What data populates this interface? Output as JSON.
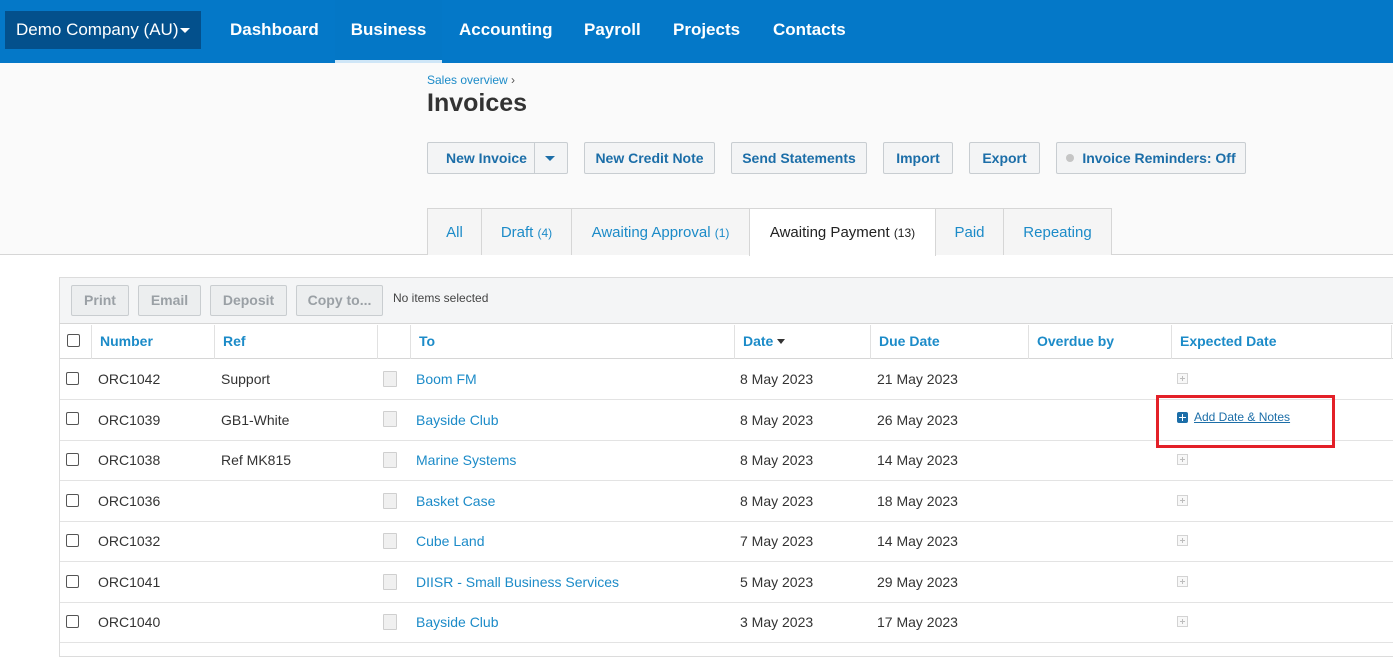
{
  "nav": {
    "org": "Demo Company (AU)",
    "items": [
      "Dashboard",
      "Business",
      "Accounting",
      "Payroll",
      "Projects",
      "Contacts"
    ]
  },
  "breadcrumb": {
    "link": "Sales overview",
    "sep": "›"
  },
  "page_title": "Invoices",
  "actions": {
    "new_invoice": "New Invoice",
    "new_credit_note": "New Credit Note",
    "send_statements": "Send Statements",
    "import": "Import",
    "export": "Export",
    "reminders": "Invoice Reminders: Off"
  },
  "tabs": [
    {
      "label": "All",
      "count": ""
    },
    {
      "label": "Draft",
      "count": "(4)"
    },
    {
      "label": "Awaiting Approval",
      "count": "(1)"
    },
    {
      "label": "Awaiting Payment",
      "count": "(13)"
    },
    {
      "label": "Paid",
      "count": ""
    },
    {
      "label": "Repeating",
      "count": ""
    }
  ],
  "toolbar": {
    "print": "Print",
    "email": "Email",
    "deposit": "Deposit",
    "copy": "Copy to...",
    "status": "No items selected"
  },
  "columns": {
    "number": "Number",
    "ref": "Ref",
    "to": "To",
    "date": "Date",
    "due": "Due Date",
    "overdue": "Overdue by",
    "expected": "Expected Date"
  },
  "rows": [
    {
      "number": "ORC1042",
      "ref": "Support",
      "to": "Boom FM",
      "date": "8 May 2023",
      "due": "21 May 2023"
    },
    {
      "number": "ORC1039",
      "ref": "GB1-White",
      "to": "Bayside Club",
      "date": "8 May 2023",
      "due": "26 May 2023"
    },
    {
      "number": "ORC1038",
      "ref": "Ref MK815",
      "to": "Marine Systems",
      "date": "8 May 2023",
      "due": "14 May 2023"
    },
    {
      "number": "ORC1036",
      "ref": "",
      "to": "Basket Case",
      "date": "8 May 2023",
      "due": "18 May 2023"
    },
    {
      "number": "ORC1032",
      "ref": "",
      "to": "Cube Land",
      "date": "7 May 2023",
      "due": "14 May 2023"
    },
    {
      "number": "ORC1041",
      "ref": "",
      "to": "DIISR - Small Business Services",
      "date": "5 May 2023",
      "due": "29 May 2023"
    },
    {
      "number": "ORC1040",
      "ref": "",
      "to": "Bayside Club",
      "date": "3 May 2023",
      "due": "17 May 2023"
    }
  ],
  "add_date_notes": "Add Date & Notes"
}
